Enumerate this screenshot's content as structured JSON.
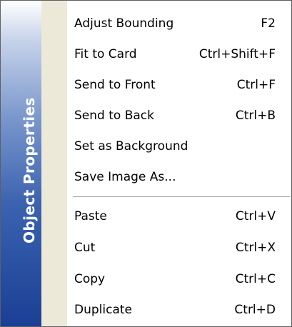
{
  "menu": {
    "banner_title": "Object Properties",
    "group1": [
      {
        "label": "Adjust Bounding",
        "shortcut": "F2"
      },
      {
        "label": "Fit to Card",
        "shortcut": "Ctrl+Shift+F"
      },
      {
        "label": "Send to Front",
        "shortcut": "Ctrl+F"
      },
      {
        "label": "Send to Back",
        "shortcut": "Ctrl+B"
      },
      {
        "label": "Set as Background",
        "shortcut": ""
      },
      {
        "label": "Save Image As...",
        "shortcut": ""
      }
    ],
    "group2": [
      {
        "label": "Paste",
        "shortcut": "Ctrl+V"
      },
      {
        "label": "Cut",
        "shortcut": "Ctrl+X"
      },
      {
        "label": "Copy",
        "shortcut": "Ctrl+C"
      },
      {
        "label": "Duplicate",
        "shortcut": "Ctrl+D"
      }
    ]
  },
  "colors": {
    "banner_top": "#ffffff",
    "banner_bottom": "#1a3f95",
    "gutter": "#ece9d8",
    "border": "#5f5f5f"
  }
}
